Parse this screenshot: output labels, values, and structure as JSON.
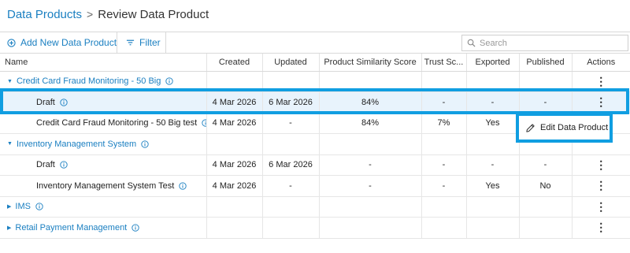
{
  "breadcrumb": {
    "root": "Data Products",
    "separator": ">",
    "current": "Review Data Product"
  },
  "toolbar": {
    "add_label": "Add New Data Product",
    "filter_label": "Filter"
  },
  "search": {
    "placeholder": "Search"
  },
  "table": {
    "headers": {
      "name": "Name",
      "created": "Created",
      "updated": "Updated",
      "similarity": "Product Similarity Score",
      "trust": "Trust Sc...",
      "exported": "Exported",
      "published": "Published",
      "actions": "Actions"
    },
    "rows": [
      {
        "name": "Credit Card Fraud Monitoring - 50 Big",
        "created": "",
        "updated": "",
        "similarity": "",
        "trust": "",
        "exported": "",
        "published": ""
      },
      {
        "name": "Draft",
        "created": "4 Mar 2026",
        "updated": "6 Mar 2026",
        "similarity": "84%",
        "trust": "-",
        "exported": "-",
        "published": "-"
      },
      {
        "name": "Credit Card Fraud Monitoring - 50 Big test",
        "created": "4 Mar 2026",
        "updated": "-",
        "similarity": "84%",
        "trust": "7%",
        "exported": "Yes",
        "published": ""
      },
      {
        "name": "Inventory Management System",
        "created": "",
        "updated": "",
        "similarity": "",
        "trust": "",
        "exported": "",
        "published": ""
      },
      {
        "name": "Draft",
        "created": "4 Mar 2026",
        "updated": "6 Mar 2026",
        "similarity": "-",
        "trust": "-",
        "exported": "-",
        "published": "-"
      },
      {
        "name": "Inventory Management System Test",
        "created": "4 Mar 2026",
        "updated": "-",
        "similarity": "-",
        "trust": "-",
        "exported": "Yes",
        "published": "No"
      },
      {
        "name": "IMS",
        "created": "",
        "updated": "",
        "similarity": "",
        "trust": "",
        "exported": "",
        "published": ""
      },
      {
        "name": "Retail Payment Management",
        "created": "",
        "updated": "",
        "similarity": "",
        "trust": "",
        "exported": "",
        "published": ""
      }
    ]
  },
  "context_menu": {
    "edit_label": "Edit Data Product"
  },
  "icons": {
    "add": "plus-circle-icon",
    "filter": "filter-icon",
    "search": "search-icon",
    "info": "info-icon",
    "kebab": "kebab-menu-icon",
    "edit": "pencil-icon",
    "expanded": "caret-down-icon",
    "collapsed": "caret-right-icon"
  },
  "colors": {
    "link": "#1a7fc1",
    "highlight": "#109ee1",
    "selected_row": "#e8f3fc"
  }
}
